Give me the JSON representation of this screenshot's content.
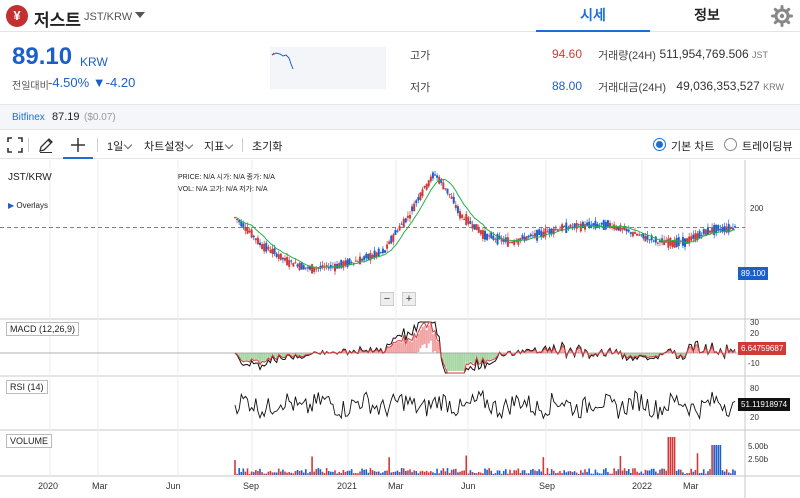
{
  "header": {
    "logo_glyph": "¥",
    "coin_name": "저스트",
    "coin_pair": "JST/KRW",
    "tabs": [
      {
        "label": "시세",
        "active": true
      },
      {
        "label": "정보",
        "active": false
      }
    ]
  },
  "price": {
    "current": "89.10",
    "unit": "KRW",
    "change_label": "전일대비",
    "change_text": "-4.50% ▼-4.20"
  },
  "stats": {
    "high_label": "고가",
    "high_value": "94.60",
    "low_label": "저가",
    "low_value": "88.00",
    "volume_label": "거래량(24H)",
    "volume_value": "511,954,769.506",
    "volume_unit": "JST",
    "amount_label": "거래대금(24H)",
    "amount_value": "49,036,353,527",
    "amount_unit": "KRW"
  },
  "exchange": {
    "name": "Bitfinex",
    "price": "87.19",
    "diff": "($0.07)"
  },
  "toolbar": {
    "interval": "1일",
    "chart_settings": "차트설정",
    "indicators": "지표",
    "reset": "초기화",
    "basic_chart": "기본 차트",
    "trading_view": "트레이딩뷰",
    "basic_selected": true
  },
  "chart": {
    "symbol": "JST/KRW",
    "overlays": "Overlays",
    "ohlc_line1": "PRICE:  N/A    시가:  N/A    종가:  N/A",
    "ohlc_line2": "VOL:     N/A    고가:  N/A    저가:  N/A",
    "zoom_minus": "−",
    "zoom_plus": "+",
    "panes": {
      "macd_label": "MACD (12,26,9)",
      "rsi_label": "RSI (14)",
      "volume_label": "VOLUME"
    },
    "tags": {
      "price": "89.100",
      "macd": "6.64759687",
      "rsi": "51.11918974"
    },
    "price_axis": [
      "200",
      "100"
    ],
    "macd_axis": [
      "30",
      "20",
      "-10"
    ],
    "rsi_axis": [
      "80",
      "20"
    ],
    "volume_axis": [
      "5.00b",
      "2.50b"
    ],
    "time_axis": [
      "2020",
      "Mar",
      "Jun",
      "Sep",
      "2021",
      "Mar",
      "Jun",
      "Sep",
      "2022",
      "Mar"
    ],
    "colors": {
      "up": "#d23a3a",
      "down": "#1d5fc9",
      "ma": "#22b34a",
      "price_tag": "#1d5fc9",
      "macd_tag": "#d23a3a",
      "rsi_tag": "#111111"
    }
  },
  "chart_data": {
    "type": "line",
    "title": "",
    "x": [
      "2020-08",
      "2020-09",
      "2020-10",
      "2020-11",
      "2020-12",
      "2021-01",
      "2021-02",
      "2021-03",
      "2021-04",
      "2021-05",
      "2021-06",
      "2021-07",
      "2021-08",
      "2021-09",
      "2021-10",
      "2021-11",
      "2021-12",
      "2022-01",
      "2022-02",
      "2022-03",
      "2022-04"
    ],
    "series": [
      {
        "name": "JST/KRW",
        "values": [
          105,
          68,
          52,
          45,
          47,
          52,
          60,
          110,
          215,
          110,
          78,
          70,
          78,
          88,
          92,
          93,
          80,
          70,
          70,
          85,
          89.1
        ]
      }
    ],
    "ylim": [
      20,
      250
    ]
  }
}
